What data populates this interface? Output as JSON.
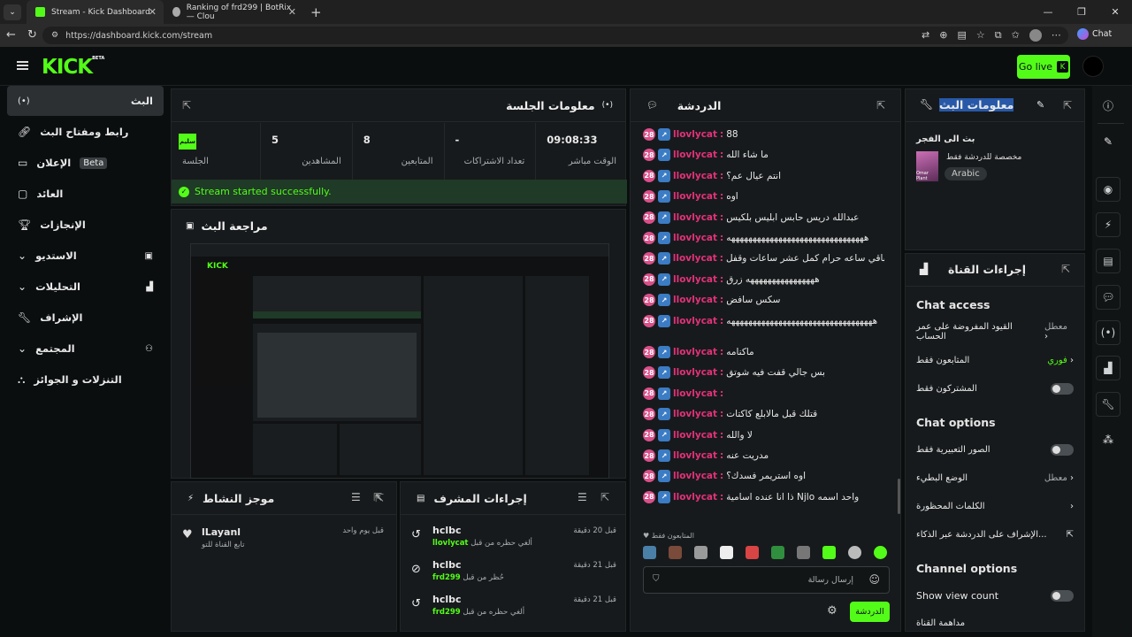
{
  "browser": {
    "tabs": [
      {
        "label": "Stream - Kick Dashboard"
      },
      {
        "label": "Ranking of frd299 | BotRix — Clou"
      }
    ],
    "url": "https://dashboard.kick.com/stream",
    "chat_btn": "Chat"
  },
  "header": {
    "logo": "KICK",
    "logo_beta": "BETA",
    "golive": "Go live"
  },
  "sidebar": {
    "items": [
      {
        "label": "البث"
      },
      {
        "label": "رابط ومفتاح البث"
      },
      {
        "label": "الإعلان",
        "badge": "Beta"
      },
      {
        "label": "العائد"
      },
      {
        "label": "الإنجازات"
      },
      {
        "label": "الاستديو"
      },
      {
        "label": "التحليلات"
      },
      {
        "label": "الإشراف"
      },
      {
        "label": "المجتمع"
      },
      {
        "label": "التنزلات و الجوائز"
      }
    ]
  },
  "session": {
    "title": "معلومات الجلسة",
    "stats": [
      {
        "value": "09:08:33",
        "label": "الوقت مباشر"
      },
      {
        "value": "-",
        "label": "تعداد الاشتراكات"
      },
      {
        "value": "8",
        "label": "المتابعين"
      },
      {
        "value": "5",
        "label": "المشاهدين"
      },
      {
        "value": "سليم",
        "label": "الجلسة"
      }
    ],
    "status": "Stream started successfully."
  },
  "preview": {
    "title": "مراجعة البث"
  },
  "activity": {
    "title": "موجز النشاط",
    "item": {
      "user": "lLayanl",
      "time": "قبل يوم واحد",
      "text": "تابع القناة للتو"
    }
  },
  "modactions": {
    "title": "إجراءات المشرف",
    "items": [
      {
        "mod": "hclbc",
        "time": "قبل 20 دقيقة",
        "text": "ألغي حظره من قبل",
        "target": "llovlycat"
      },
      {
        "mod": "hclbc",
        "time": "قبل 21 دقيقة",
        "text": "حُظر من قبل",
        "target": "frd299"
      },
      {
        "mod": "hclbc",
        "time": "قبل 21 دقيقة",
        "text": "ألغي حظره من قبل",
        "target": "frd299"
      }
    ]
  },
  "chat": {
    "title": "الدردشة",
    "user": "llovlycat",
    "messages": [
      "88",
      "ما شاء الله",
      "انتم عيال عم؟",
      "اوه",
      "عبدالله دريس حابس ابليس بلكيس",
      "ههههههههههههههههههههههههههههههههه",
      "باقي ساعه حرام كمل عشر ساعات وقفل",
      "ههههههههههههههههه زرق",
      "سكس سافض",
      "ههههههههههههههههههههههههههههههههههه",
      "ماكنامه",
      "بس جالي قفت فيه شوتق",
      "",
      "قتلك قبل مالابلع كاكتات",
      "لا والله",
      "مدريت عنه",
      "اوه استريمر فسدك؟",
      "ذا انا عنده اسامية Njlo واحد اسمه"
    ],
    "followers_only": "المتابعون فقط",
    "input_placeholder": "إرسال رسالة",
    "send": "الدردشة"
  },
  "streaminfo": {
    "title": "معلومات البث",
    "stream_title": "بث الى الفجر",
    "desc": "مخصصة للدردشة فقط",
    "lang": "Arabic",
    "thumb_text": "Omar Plant"
  },
  "channel": {
    "title": "إجراءات القناة",
    "chat_access": "Chat access",
    "rows": [
      {
        "label": "القيود المفروضة على عمر الحساب",
        "value": "معطل"
      },
      {
        "label": "المتابعون فقط",
        "value": "فوري"
      },
      {
        "label": "المشتركون فقط",
        "value": ""
      }
    ],
    "chat_options": "Chat options",
    "opt_rows": [
      {
        "label": "الصور التعبيرية فقط",
        "value": ""
      },
      {
        "label": "الوضع البطيء",
        "value": "معطل"
      },
      {
        "label": "الكلمات المحظورة",
        "value": ""
      },
      {
        "label": "الإشراف على الدردشة عبر الذكاء...",
        "value": ""
      }
    ],
    "channel_options": "Channel options",
    "show_view": "Show view count",
    "last": "مداهمة القناة"
  }
}
